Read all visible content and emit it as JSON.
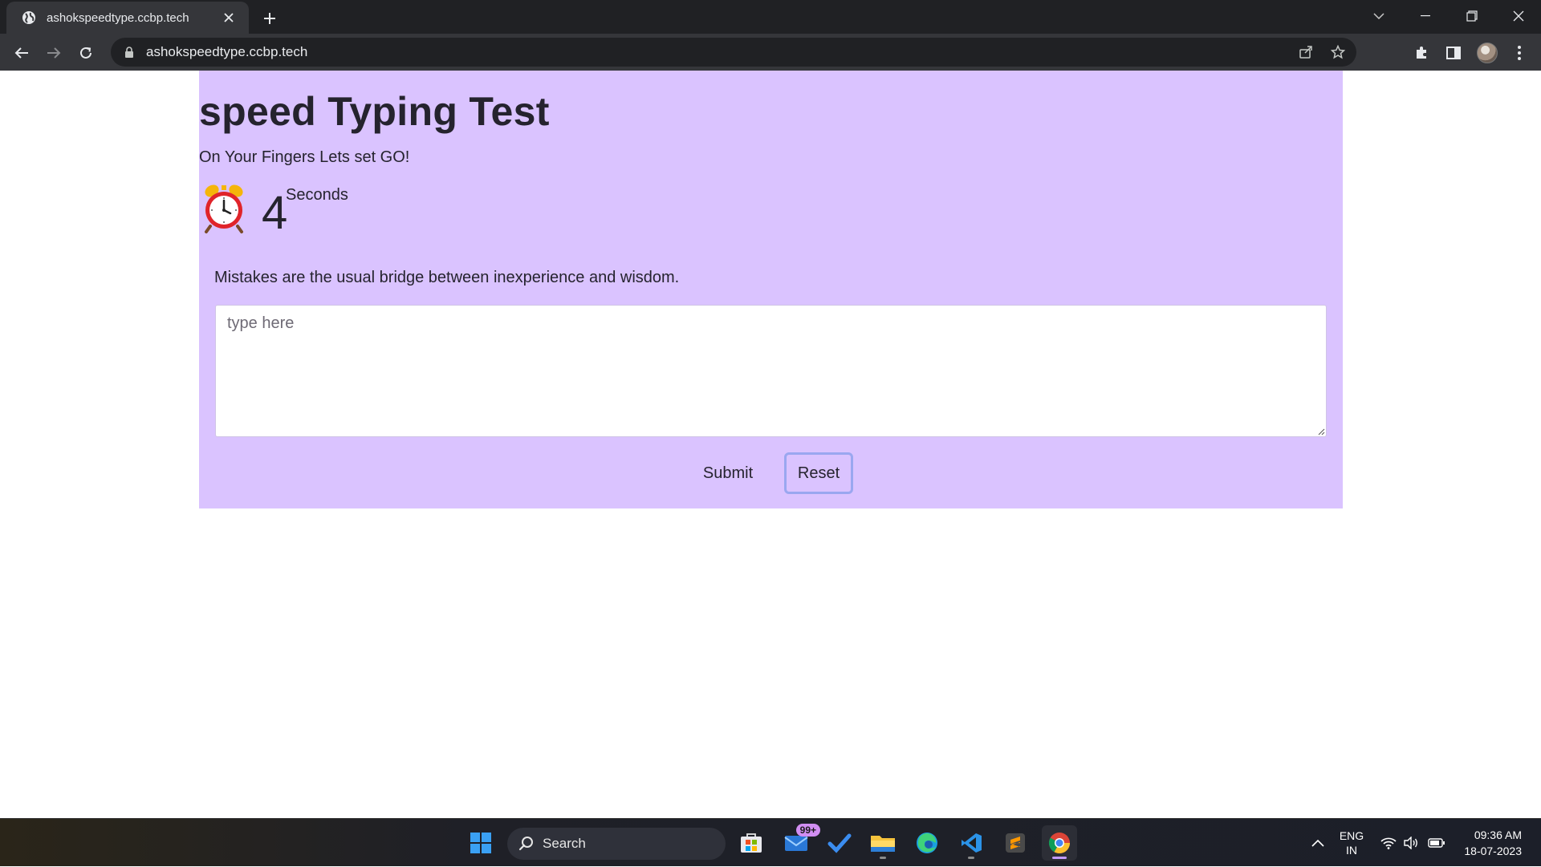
{
  "browser": {
    "tab_title": "ashokspeedtype.ccbp.tech",
    "url": "ashokspeedtype.ccbp.tech"
  },
  "page": {
    "heading": "speed Typing Test",
    "subtitle": "On Your Fingers Lets set GO!",
    "timer": {
      "value": "4",
      "unit": "Seconds"
    },
    "quote": "Mistakes are the usual bridge between inexperience and wisdom.",
    "input": {
      "placeholder": "type here",
      "value": ""
    },
    "submit_label": "Submit",
    "reset_label": "Reset",
    "colors": {
      "card_background": "#dac3ff",
      "reset_focus_ring": "#9aa7f0",
      "text": "#25232e"
    }
  },
  "taskbar": {
    "search_label": "Search",
    "mail_badge": "99+",
    "lang_line1": "ENG",
    "lang_line2": "IN",
    "time": "09:36 AM",
    "date": "18-07-2023"
  }
}
